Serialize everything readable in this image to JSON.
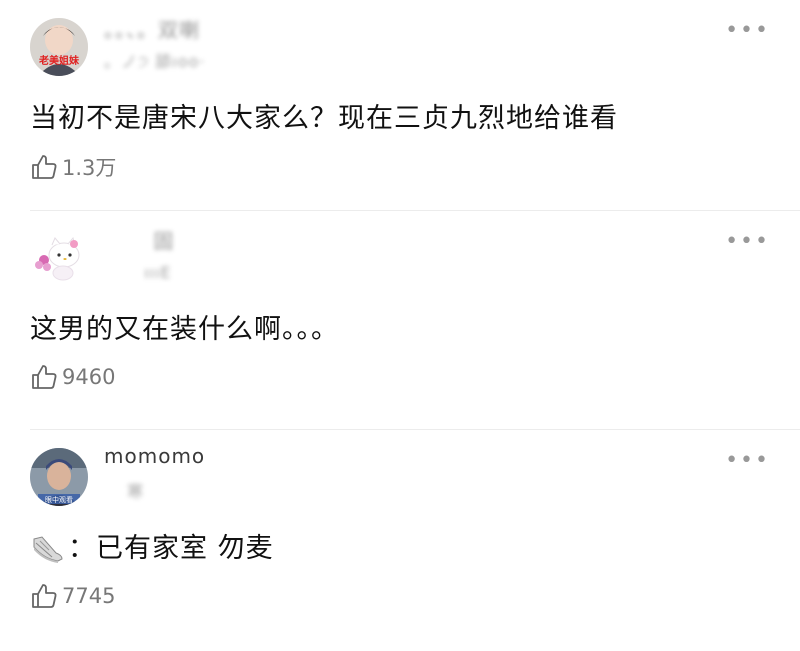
{
  "comments": [
    {
      "username": "。。、。双喇",
      "subtext": "。ノ੭ 舔ıоо·",
      "avatar_badge": "老美姐妹",
      "text": "当初不是唐宋八大家么？现在三贞九烈地给谁看",
      "likes": "1.3万"
    },
    {
      "username": "　　 固",
      "subtext": "　　 ıııE",
      "text": "这男的又在装什么啊。。。",
      "likes": "9460"
    },
    {
      "username": "momomo",
      "subtext": "　 寒",
      "avatar_badge": "眼中观看",
      "text": "：已有家室 勿麦",
      "likes": "7745"
    }
  ],
  "more_icon": "more-dots-icon",
  "like_icon": "thumbs-up-icon"
}
